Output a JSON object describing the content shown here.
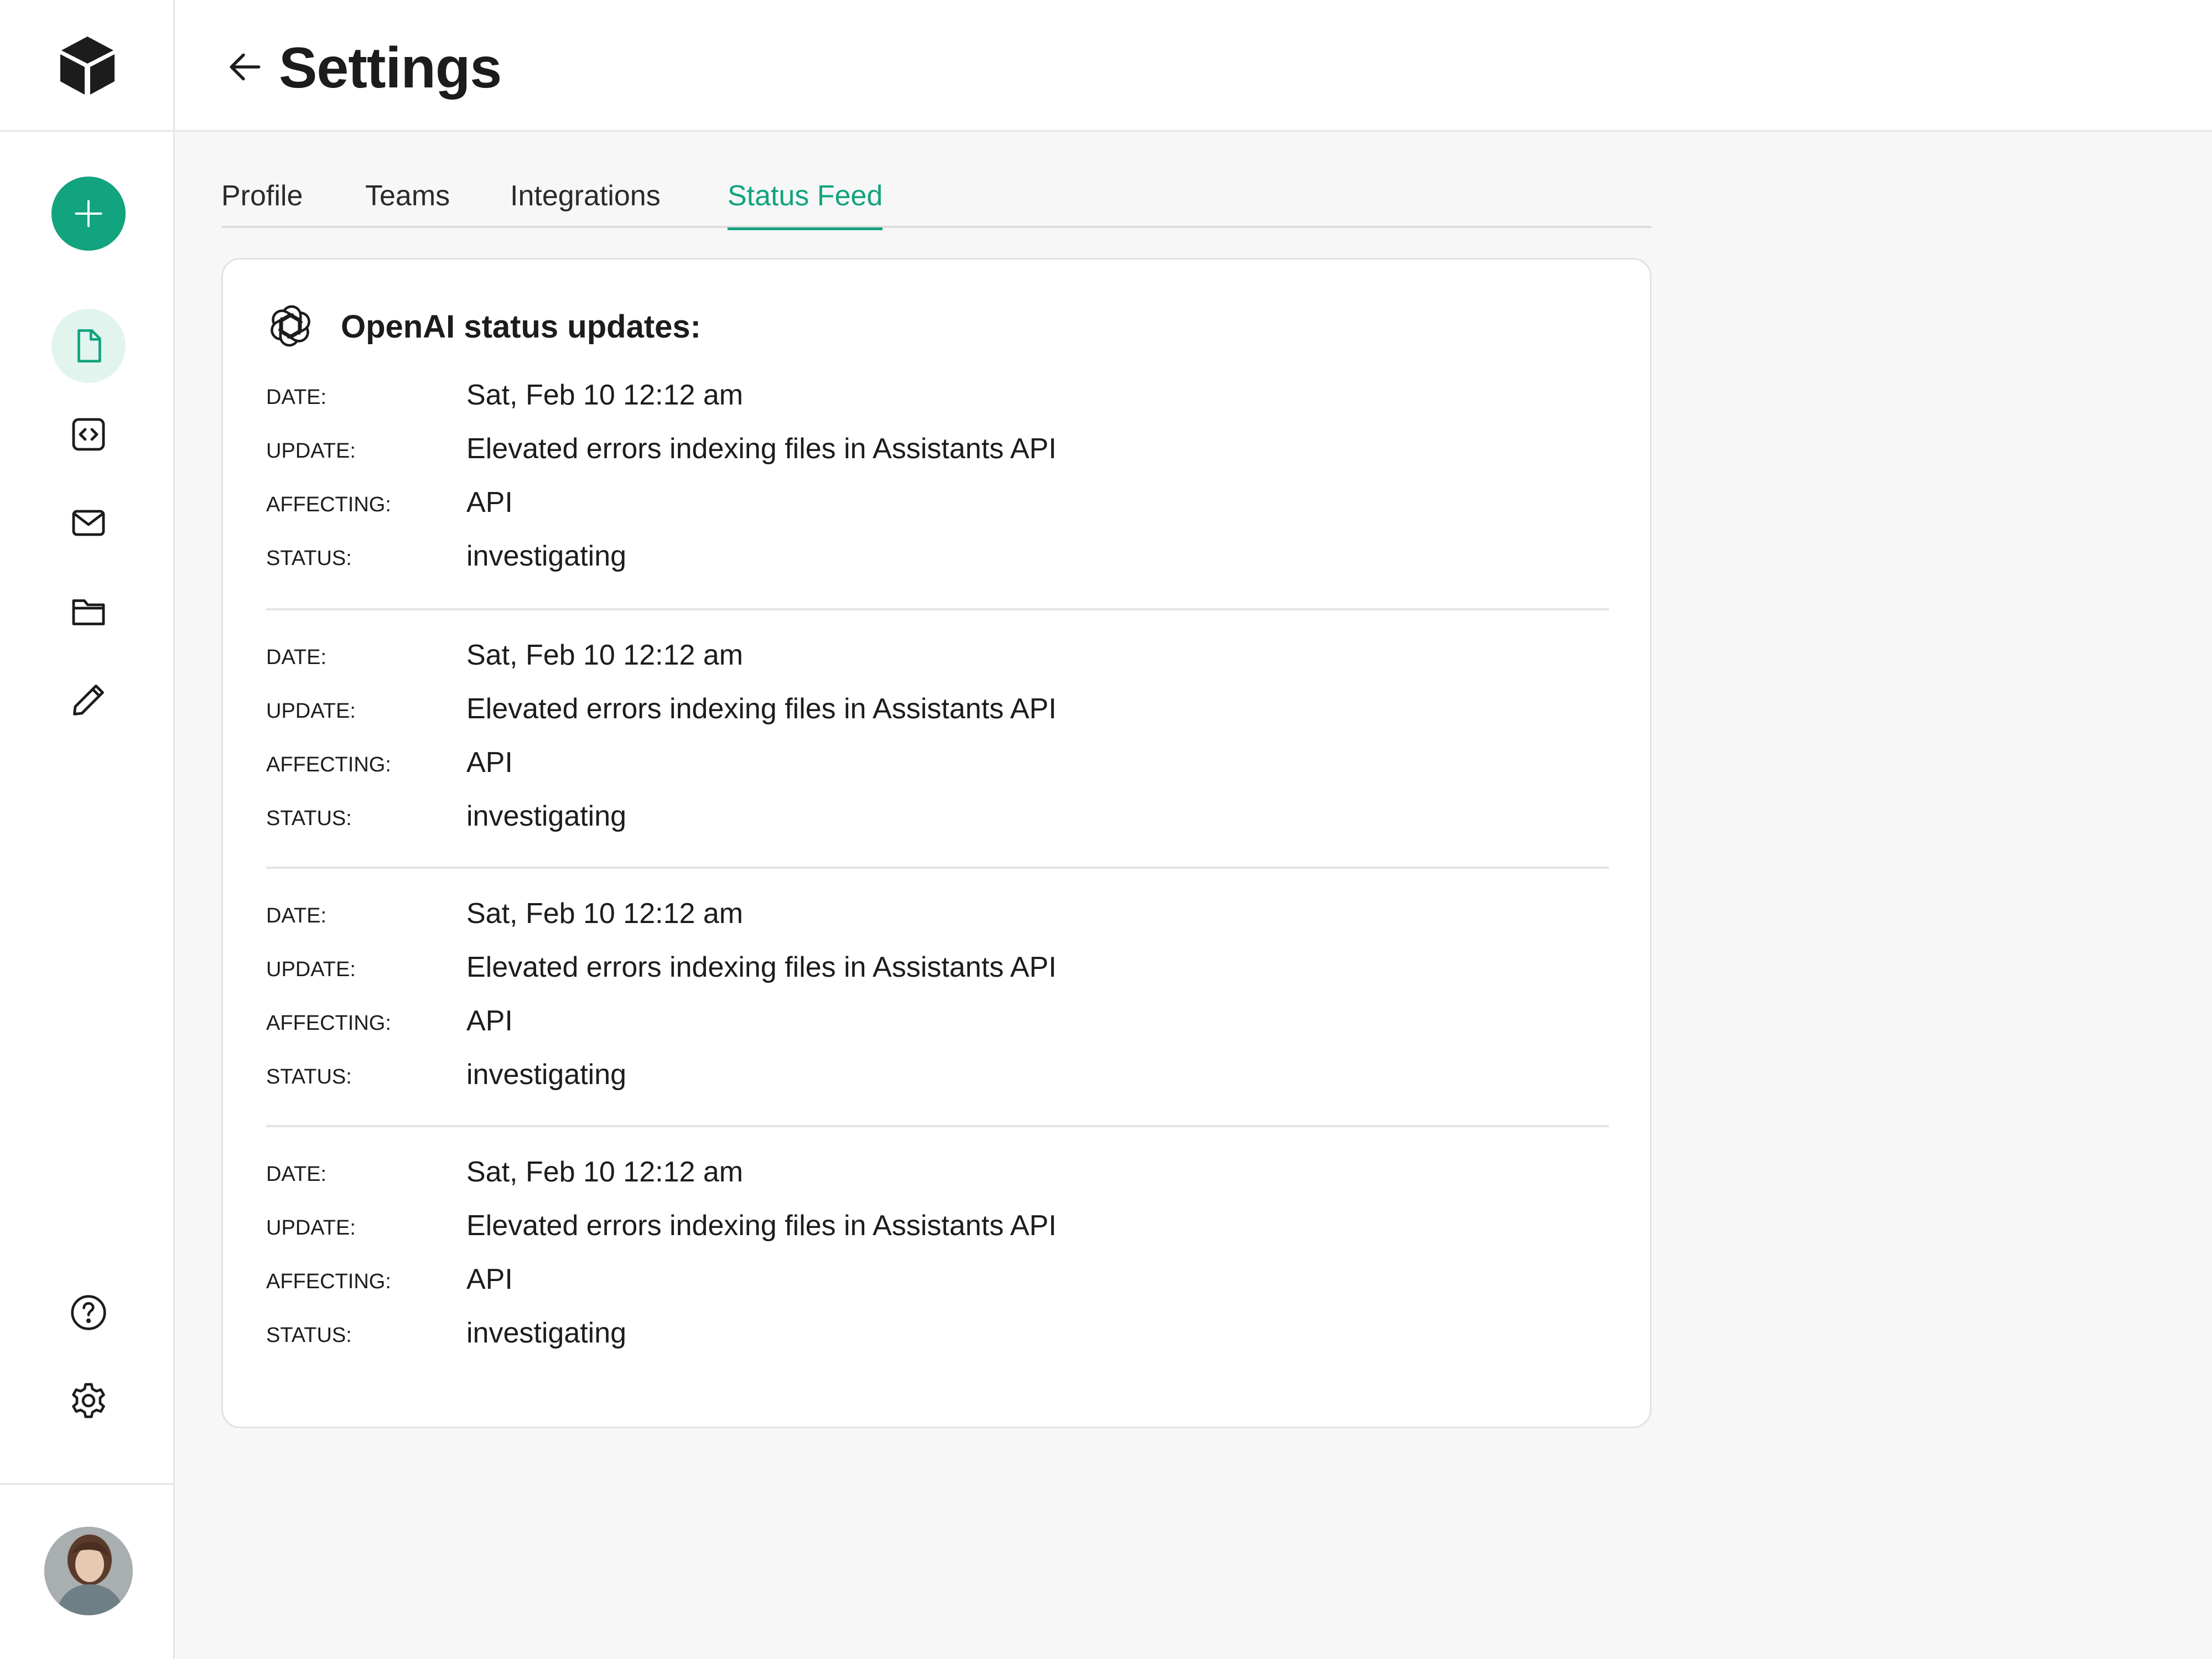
{
  "app": {
    "title": "Settings",
    "accent_color": "#12a37f"
  },
  "sidebar": {
    "logo_icon": "cube-icon",
    "new_button_icon": "plus-icon",
    "nav_items": [
      {
        "icon": "document-icon",
        "active": true
      },
      {
        "icon": "code-icon",
        "active": false
      },
      {
        "icon": "mail-icon",
        "active": false
      },
      {
        "icon": "folder-icon",
        "active": false
      },
      {
        "icon": "pencil-icon",
        "active": false
      }
    ],
    "bottom_items": [
      {
        "icon": "help-icon"
      },
      {
        "icon": "gear-icon"
      }
    ],
    "avatar": "user-avatar"
  },
  "tabs": [
    {
      "label": "Profile",
      "active": false
    },
    {
      "label": "Teams",
      "active": false
    },
    {
      "label": "Integrations",
      "active": false
    },
    {
      "label": "Status Feed",
      "active": true
    }
  ],
  "status_card": {
    "icon": "openai-logo-icon",
    "title": "OpenAI status updates:",
    "labels": {
      "date": "DATE:",
      "update": "UPDATE:",
      "affecting": "AFFECTING:",
      "status": "STATUS:"
    },
    "entries": [
      {
        "date": "Sat, Feb 10 12:12 am",
        "update": "Elevated errors indexing files in Assistants API",
        "affecting": "API",
        "status": "investigating"
      },
      {
        "date": "Sat, Feb 10 12:12 am",
        "update": "Elevated errors indexing files in Assistants API",
        "affecting": "API",
        "status": "investigating"
      },
      {
        "date": "Sat, Feb 10 12:12 am",
        "update": "Elevated errors indexing files in Assistants API",
        "affecting": "API",
        "status": "investigating"
      },
      {
        "date": "Sat, Feb 10 12:12 am",
        "update": "Elevated errors indexing files in Assistants API",
        "affecting": "API",
        "status": "investigating"
      }
    ]
  }
}
